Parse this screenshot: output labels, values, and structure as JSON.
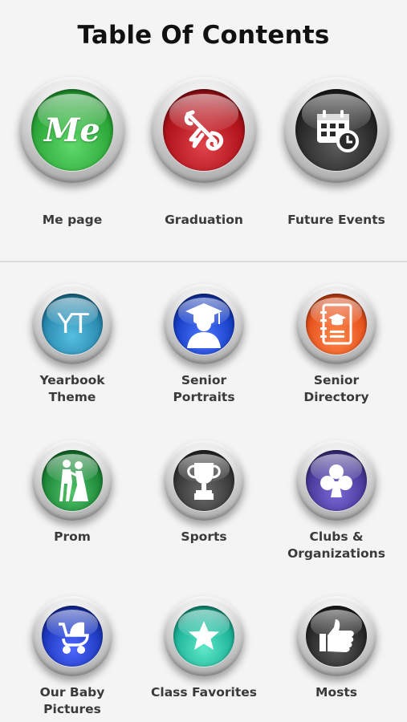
{
  "page": {
    "title": "Table Of Contents"
  },
  "top_items": [
    {
      "label": "Me page",
      "icon": "me-text-icon",
      "color": "#2eaa3a",
      "glyph": "Me"
    },
    {
      "label": "Graduation",
      "icon": "diploma-icon",
      "color": "#b3141c"
    },
    {
      "label": "Future Events",
      "icon": "calendar-clock-icon",
      "color": "#2a2a2a"
    }
  ],
  "grid_items": [
    {
      "label_line1": "Yearbook",
      "label_line2": "Theme",
      "icon": "yt-text-icon",
      "color": "#2a8bb0",
      "glyph": "YT"
    },
    {
      "label_line1": "Senior",
      "label_line2": "Portraits",
      "icon": "graduate-icon",
      "color": "#1840c8"
    },
    {
      "label_line1": "Senior",
      "label_line2": "Directory",
      "icon": "directory-book-icon",
      "color": "#e8541e"
    },
    {
      "label_line1": "Prom",
      "label_line2": "",
      "icon": "dancing-couple-icon",
      "color": "#1f8a3a"
    },
    {
      "label_line1": "Sports",
      "label_line2": "",
      "icon": "trophy-icon",
      "color": "#3a3a3a"
    },
    {
      "label_line1": "Clubs &",
      "label_line2": "Organizations",
      "icon": "club-suit-icon",
      "color": "#4a3a9a"
    },
    {
      "label_line1": "Our Baby",
      "label_line2": "Pictures",
      "icon": "stroller-icon",
      "color": "#1f3ac0"
    },
    {
      "label_line1": "Class Favorites",
      "label_line2": "",
      "icon": "star-icon",
      "color": "#1fb59a"
    },
    {
      "label_line1": "Mosts",
      "label_line2": "",
      "icon": "thumbs-up-icon",
      "color": "#2a2a2a"
    }
  ]
}
